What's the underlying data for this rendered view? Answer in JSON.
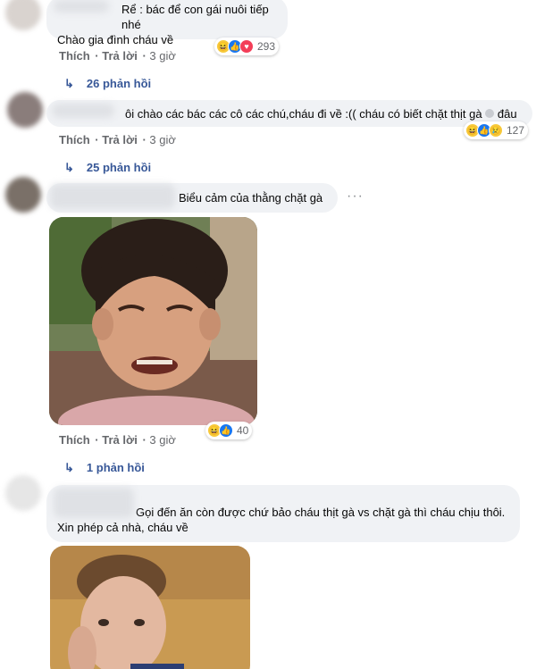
{
  "comments": [
    {
      "text_lines": [
        "Rể : bác để con gái nuôi tiếp nhé",
        "Chào gia đình cháu về"
      ],
      "reactions": [
        "haha",
        "like",
        "love"
      ],
      "reaction_count": "293",
      "actions": {
        "like": "Thích",
        "reply": "Trả lời",
        "time": "3 giờ"
      },
      "replies": "26 phản hồi"
    },
    {
      "text": "ôi chào các bác các cô các chú,cháu đi về :(( cháu có biết chặt thịt gà",
      "text_tail": "đâu",
      "reactions": [
        "haha",
        "like",
        "sad"
      ],
      "reaction_count": "127",
      "actions": {
        "like": "Thích",
        "reply": "Trả lời",
        "time": "3 giờ"
      },
      "replies": "25 phản hồi"
    },
    {
      "text": "Biểu cảm của thằng chặt gà",
      "more": "···",
      "reactions": [
        "haha",
        "like"
      ],
      "reaction_count": "40",
      "actions": {
        "like": "Thích",
        "reply": "Trả lời",
        "time": "3 giờ"
      },
      "replies": "1 phản hồi"
    },
    {
      "text_lines": [
        "Gọi đến ăn còn được chứ bảo cháu thịt gà vs chặt gà thì cháu chịu thôi.",
        "Xin phép cả nhà, cháu về"
      ]
    }
  ],
  "colors": {
    "bubble": "#f0f2f5",
    "link": "#385898",
    "meta": "#65676b"
  }
}
